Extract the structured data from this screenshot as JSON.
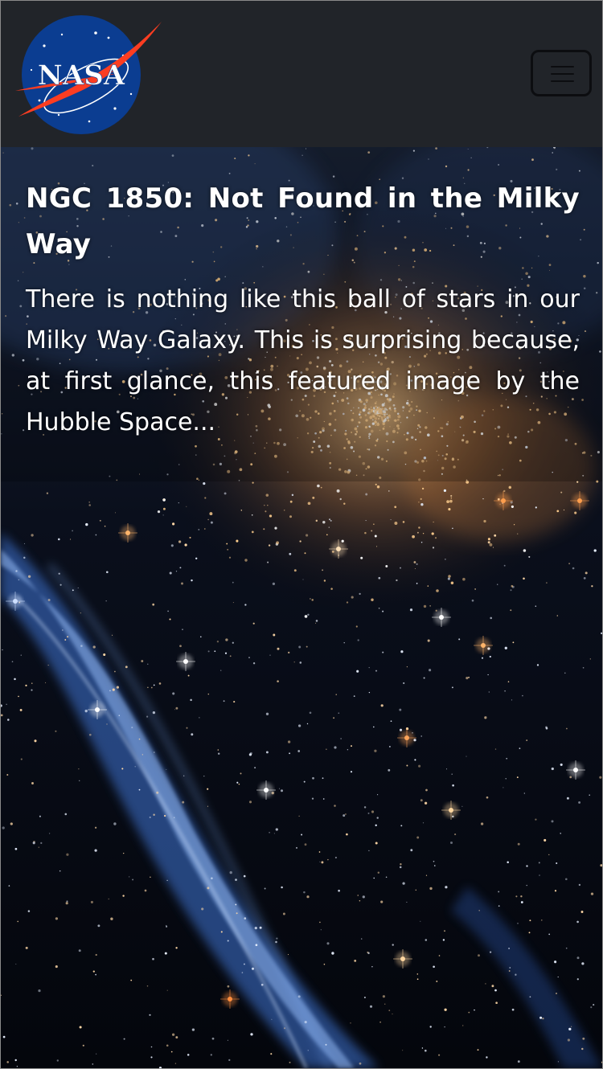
{
  "navbar": {
    "logo": {
      "icon": "nasa-meatball-logo",
      "text": "NASA"
    },
    "toggler_icon": "hamburger-menu-icon"
  },
  "article": {
    "title": "NGC 1850: Not Found in the Milky Way",
    "summary": "There is nothing like this ball of stars in our Milky Way Galaxy. This is surprising because, at first glance, this featured image by the Hubble Space..."
  },
  "colors": {
    "navbar_bg": "#212429",
    "nasa_blue": "#0b3d91",
    "nasa_red": "#fc3d21",
    "text": "#ffffff"
  }
}
